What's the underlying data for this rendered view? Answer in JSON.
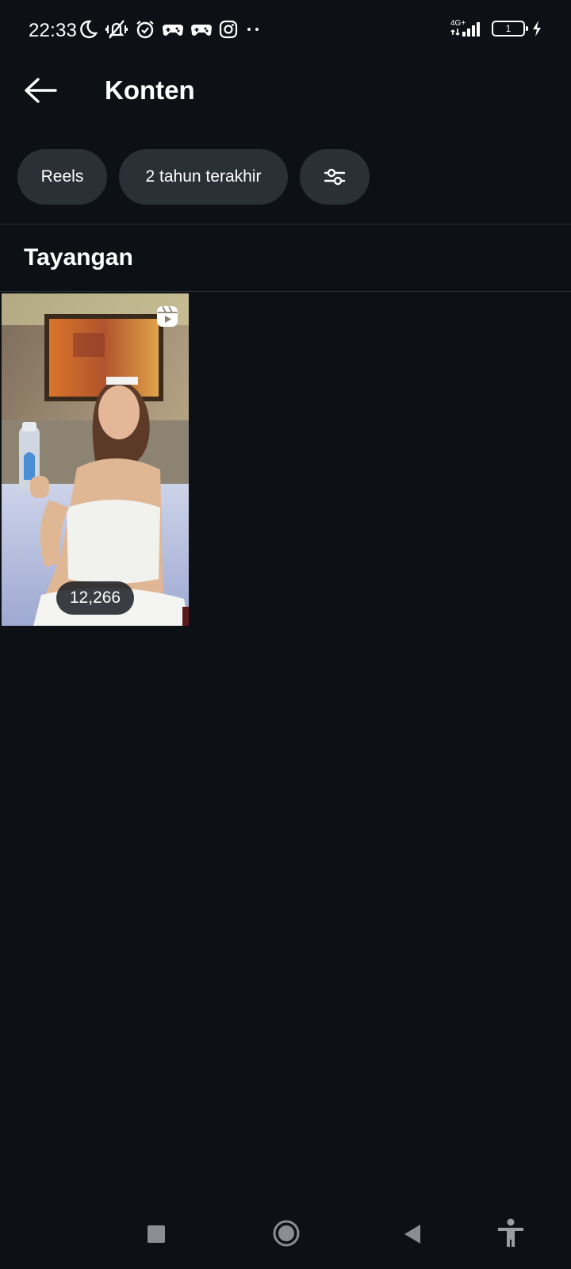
{
  "status_bar": {
    "time": "22:33",
    "network": "4G+",
    "battery": "1",
    "icons": [
      "moon-icon",
      "vibrate-off-icon",
      "alarm-icon",
      "game-icon",
      "game-icon",
      "instagram-icon",
      "more-dots-icon",
      "signal-icon",
      "battery-icon",
      "charging-icon"
    ]
  },
  "header": {
    "title": "Konten"
  },
  "filters": {
    "type_label": "Reels",
    "period_label": "2 tahun terakhir"
  },
  "section": {
    "title": "Tayangan"
  },
  "content_items": [
    {
      "type": "reel",
      "views": "12,266"
    }
  ],
  "nav_bar": {
    "buttons": [
      "recents-button",
      "home-button",
      "back-nav-button",
      "accessibility-button"
    ]
  },
  "colors": {
    "background": "#0d1015",
    "chip": "#2b2f36",
    "text": "#ffffff"
  }
}
